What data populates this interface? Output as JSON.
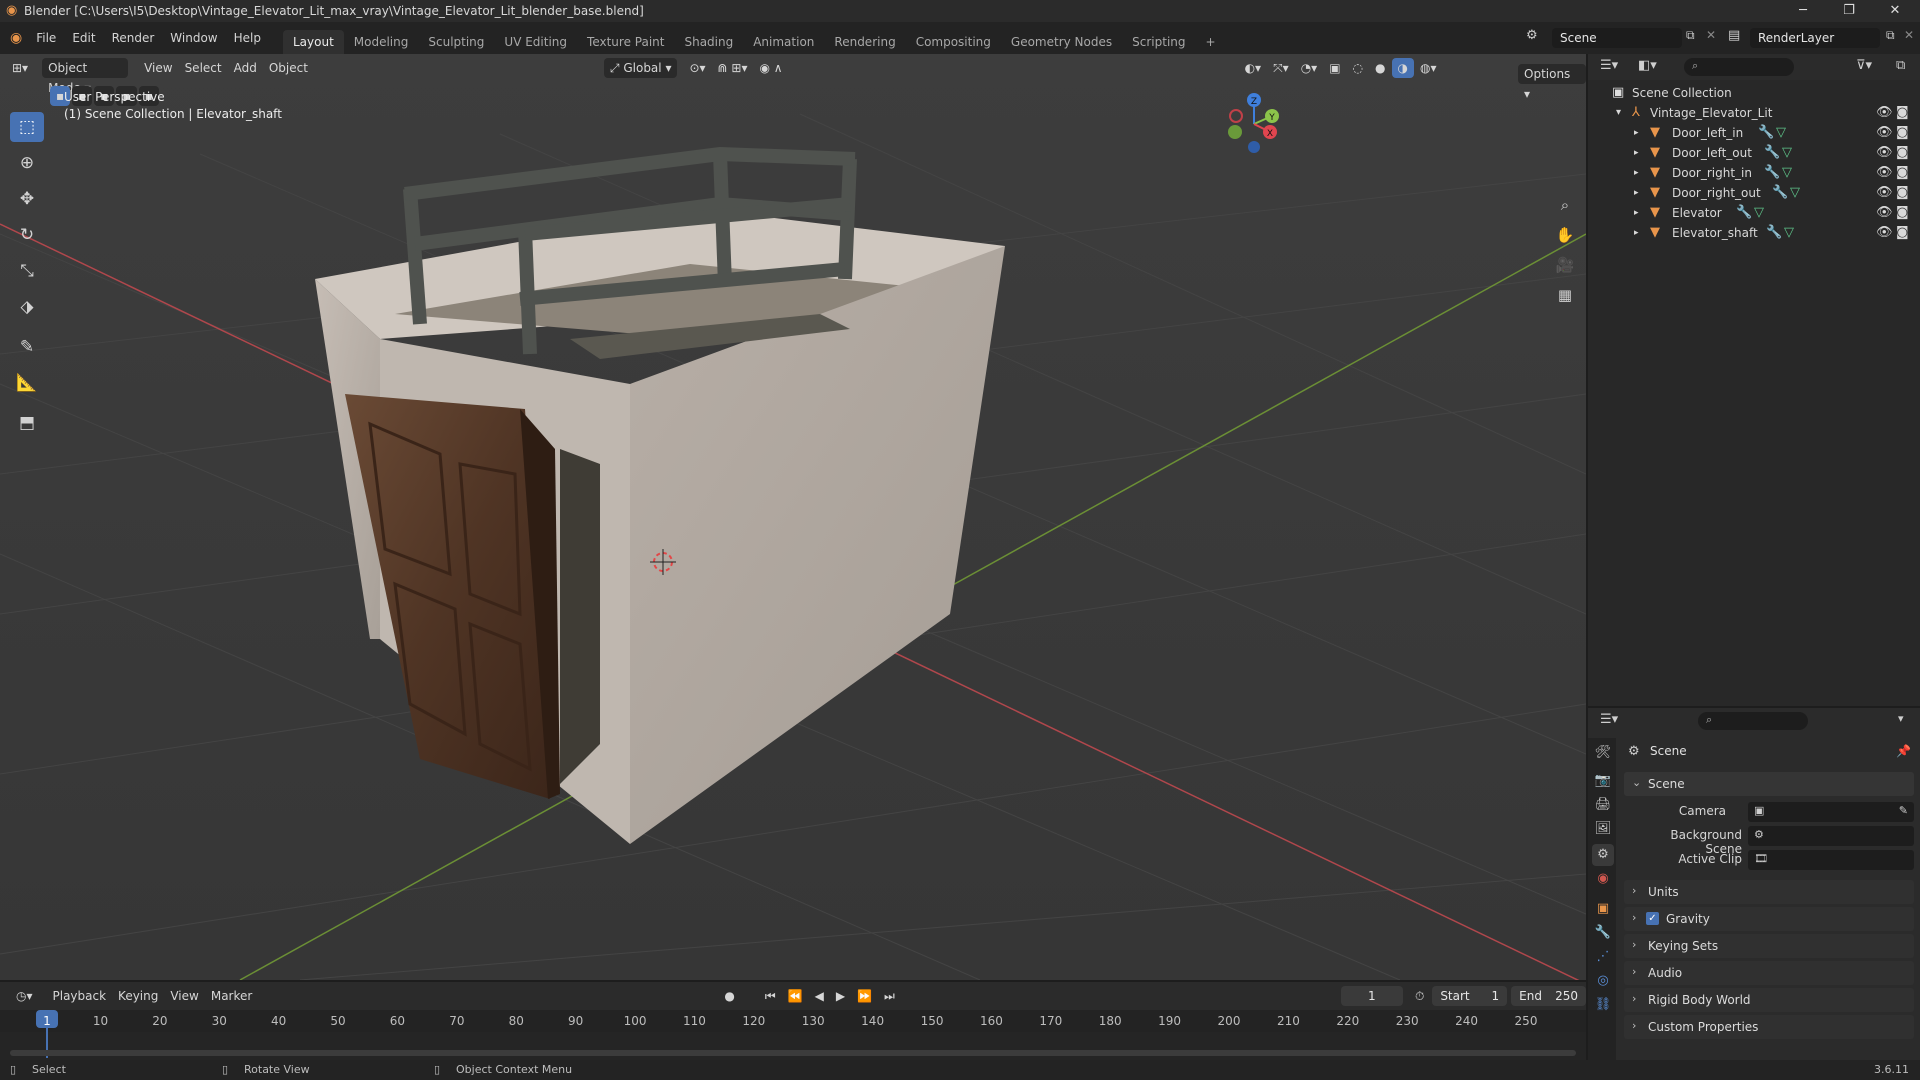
{
  "titlebar": {
    "title": "Blender [C:\\Users\\I5\\Desktop\\Vintage_Elevator_Lit_max_vray\\Vintage_Elevator_Lit_blender_base.blend]",
    "minimize": "─",
    "maximize": "❐",
    "close": "✕"
  },
  "menubar": {
    "menus": [
      "File",
      "Edit",
      "Render",
      "Window",
      "Help"
    ],
    "workspaces": [
      "Layout",
      "Modeling",
      "Sculpting",
      "UV Editing",
      "Texture Paint",
      "Shading",
      "Animation",
      "Rendering",
      "Compositing",
      "Geometry Nodes",
      "Scripting"
    ],
    "add_tab": "+",
    "scene": "Scene",
    "view_layer": "RenderLayer"
  },
  "viewport": {
    "mode": "Object Mode",
    "menus": [
      "View",
      "Select",
      "Add",
      "Object"
    ],
    "transform_orientation": "Global",
    "options": "Options",
    "overlay_line1": "User Perspective",
    "overlay_line2": "(1) Scene Collection | Elevator_shaft",
    "gizmo": {
      "z": "Z",
      "y": "Y",
      "x": "X"
    }
  },
  "outliner": {
    "root": "Scene Collection",
    "collection": "Vintage_Elevator_Lit",
    "objects": [
      "Door_left_in",
      "Door_left_out",
      "Door_right_in",
      "Door_right_out",
      "Elevator",
      "Elevator_shaft"
    ]
  },
  "properties": {
    "header": "Scene",
    "panel_scene": "Scene",
    "camera_label": "Camera",
    "background_scene_label": "Background Scene",
    "active_clip_label": "Active Clip",
    "panels": [
      "Units",
      "Gravity",
      "Keying Sets",
      "Audio",
      "Rigid Body World",
      "Custom Properties"
    ],
    "gravity_checked": true
  },
  "timeline": {
    "menus": [
      "Playback",
      "Keying",
      "View",
      "Marker"
    ],
    "current_frame": "1",
    "start_label": "Start",
    "start": "1",
    "end_label": "End",
    "end": "250",
    "ticks": [
      "1",
      "10",
      "20",
      "30",
      "40",
      "50",
      "60",
      "70",
      "80",
      "90",
      "100",
      "110",
      "120",
      "130",
      "140",
      "150",
      "160",
      "170",
      "180",
      "190",
      "200",
      "210",
      "220",
      "230",
      "240",
      "250"
    ]
  },
  "statusbar": {
    "select": "Select",
    "rotate": "Rotate View",
    "context": "Object Context Menu",
    "version": "3.6.11"
  },
  "colors": {
    "accent": "#4772b3",
    "x_axis": "#e0454f",
    "y_axis": "#8bc34a",
    "z_axis": "#3f7fdc",
    "mesh_icon": "#e8954b"
  }
}
